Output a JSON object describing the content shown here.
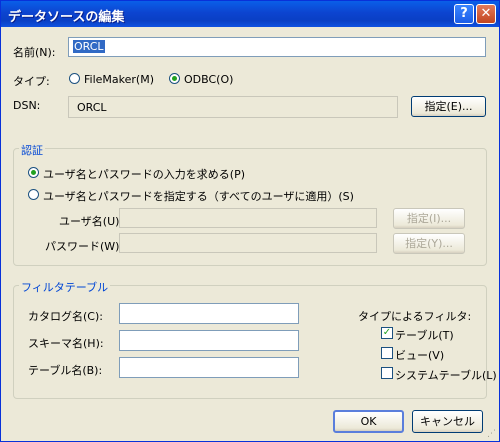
{
  "window": {
    "title": "データソースの編集",
    "help_icon": "?",
    "close_icon": "✕"
  },
  "name": {
    "label": "名前(N):",
    "value": "ORCL"
  },
  "type": {
    "label": "タイプ:",
    "options": [
      "FileMaker(M)",
      "ODBC(O)"
    ],
    "selected": "ODBC(O)"
  },
  "dsn": {
    "label": "DSN:",
    "value": "ORCL",
    "button": "指定(E)..."
  },
  "auth": {
    "legend": "認証",
    "options": [
      "ユーザ名とパスワードの入力を求める(P)",
      "ユーザ名とパスワードを指定する（すべてのユーザに適用）(S)"
    ],
    "selected": "ユーザ名とパスワードの入力を求める(P)",
    "user_label": "ユーザ名(U):",
    "user_button": "指定(I)...",
    "password_label": "パスワード(W):",
    "password_button": "指定(Y)..."
  },
  "filter": {
    "legend": "フィルタテーブル",
    "catalog_label": "カタログ名(C):",
    "schema_label": "スキーマ名(H):",
    "table_label": "テーブル名(B):",
    "type_filter_label": "タイプによるフィルタ:",
    "checks": [
      {
        "label": "テーブル(T)",
        "checked": true
      },
      {
        "label": "ビュー(V)",
        "checked": false
      },
      {
        "label": "システムテーブル(L)",
        "checked": false
      }
    ]
  },
  "buttons": {
    "ok": "OK",
    "cancel": "キャンセル"
  }
}
